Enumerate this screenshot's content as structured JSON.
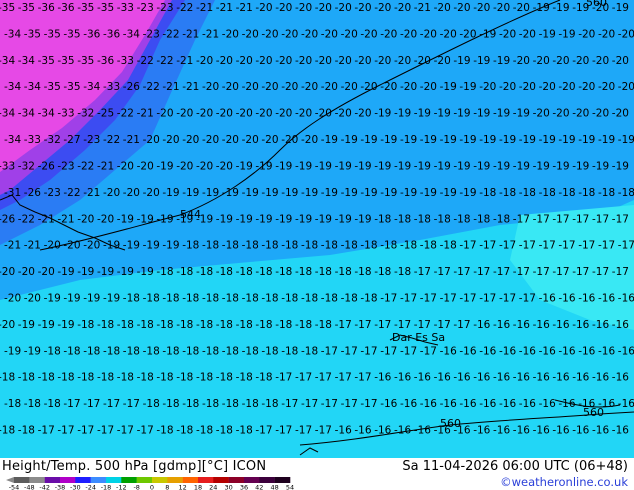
{
  "map": {
    "grid_values": [
      [
        "-35",
        "-35",
        "-36",
        "-36",
        "-35",
        "-35",
        "-33",
        "-23",
        "-23",
        "-22",
        "-21",
        "-21",
        "-21",
        "-20",
        "-20",
        "-20",
        "-20",
        "-20",
        "-20",
        "-20",
        "-20",
        "-21",
        "-20",
        "-20",
        "-20",
        "-20",
        "-20",
        "-19",
        "-19",
        "-19",
        "-20",
        "-19"
      ],
      [
        "-34",
        "-35",
        "-35",
        "-35",
        "-36",
        "-36",
        "-34",
        "-23",
        "-22",
        "-21",
        "-21",
        "-20",
        "-20",
        "-20",
        "-20",
        "-20",
        "-20",
        "-20",
        "-20",
        "-20",
        "-20",
        "-20",
        "-20",
        "-20",
        "-19",
        "-20",
        "-20",
        "-19",
        "-19",
        "-20",
        "-20",
        "-20"
      ],
      [
        "-34",
        "-34",
        "-35",
        "-35",
        "-35",
        "-36",
        "-33",
        "-22",
        "-22",
        "-21",
        "-20",
        "-20",
        "-20",
        "-20",
        "-20",
        "-20",
        "-20",
        "-20",
        "-20",
        "-20",
        "-20",
        "-20",
        "-20",
        "-19",
        "-19",
        "-19",
        "-20",
        "-20",
        "-20",
        "-20",
        "-20",
        "-20"
      ],
      [
        "-34",
        "-34",
        "-35",
        "-35",
        "-34",
        "-33",
        "-26",
        "-22",
        "-21",
        "-21",
        "-20",
        "-20",
        "-20",
        "-20",
        "-20",
        "-20",
        "-20",
        "-20",
        "-20",
        "-20",
        "-20",
        "-20",
        "-19",
        "-19",
        "-20",
        "-20",
        "-20",
        "-20",
        "-20",
        "-20",
        "-20",
        "-20"
      ],
      [
        "-34",
        "-34",
        "-34",
        "-33",
        "-32",
        "-25",
        "-22",
        "-21",
        "-20",
        "-20",
        "-20",
        "-20",
        "-20",
        "-20",
        "-20",
        "-20",
        "-20",
        "-20",
        "-20",
        "-19",
        "-19",
        "-19",
        "-19",
        "-19",
        "-19",
        "-19",
        "-19",
        "-20",
        "-20",
        "-20",
        "-20",
        "-20"
      ],
      [
        "-34",
        "-33",
        "-32",
        "-27",
        "-23",
        "-22",
        "-21",
        "-20",
        "-20",
        "-20",
        "-20",
        "-20",
        "-20",
        "-20",
        "-20",
        "-20",
        "-19",
        "-19",
        "-19",
        "-19",
        "-19",
        "-19",
        "-19",
        "-19",
        "-19",
        "-19",
        "-19",
        "-19",
        "-19",
        "-19",
        "-19",
        "-19"
      ],
      [
        "-33",
        "-32",
        "-26",
        "-23",
        "-22",
        "-21",
        "-20",
        "-20",
        "-19",
        "-20",
        "-20",
        "-20",
        "-19",
        "-19",
        "-19",
        "-19",
        "-19",
        "-19",
        "-19",
        "-19",
        "-19",
        "-19",
        "-19",
        "-19",
        "-19",
        "-19",
        "-19",
        "-19",
        "-19",
        "-19",
        "-19",
        "-19"
      ],
      [
        "-31",
        "-26",
        "-23",
        "-22",
        "-21",
        "-20",
        "-20",
        "-20",
        "-19",
        "-19",
        "-19",
        "-19",
        "-19",
        "-19",
        "-19",
        "-19",
        "-19",
        "-19",
        "-19",
        "-19",
        "-19",
        "-19",
        "-19",
        "-19",
        "-18",
        "-18",
        "-18",
        "-18",
        "-18",
        "-18",
        "-18",
        "-18"
      ],
      [
        "-26",
        "-22",
        "-21",
        "-21",
        "-20",
        "-20",
        "-19",
        "-19",
        "-19",
        "-19",
        "-19",
        "-19",
        "-19",
        "-19",
        "-19",
        "-19",
        "-19",
        "-19",
        "-19",
        "-18",
        "-18",
        "-18",
        "-18",
        "-18",
        "-18",
        "-18",
        "-17",
        "-17",
        "-17",
        "-17",
        "-17",
        "-17"
      ],
      [
        "-21",
        "-21",
        "-20",
        "-20",
        "-20",
        "-19",
        "-19",
        "-19",
        "-19",
        "-18",
        "-18",
        "-18",
        "-18",
        "-18",
        "-18",
        "-18",
        "-18",
        "-18",
        "-18",
        "-18",
        "-18",
        "-18",
        "-18",
        "-17",
        "-17",
        "-17",
        "-17",
        "-17",
        "-17",
        "-17",
        "-17",
        "-17"
      ],
      [
        "-20",
        "-20",
        "-20",
        "-19",
        "-19",
        "-19",
        "-19",
        "-19",
        "-18",
        "-18",
        "-18",
        "-18",
        "-18",
        "-18",
        "-18",
        "-18",
        "-18",
        "-18",
        "-18",
        "-18",
        "-18",
        "-17",
        "-17",
        "-17",
        "-17",
        "-17",
        "-17",
        "-17",
        "-17",
        "-17",
        "-17",
        "-17"
      ],
      [
        "-20",
        "-20",
        "-19",
        "-19",
        "-19",
        "-19",
        "-18",
        "-18",
        "-18",
        "-18",
        "-18",
        "-18",
        "-18",
        "-18",
        "-18",
        "-18",
        "-18",
        "-18",
        "-18",
        "-17",
        "-17",
        "-17",
        "-17",
        "-17",
        "-17",
        "-17",
        "-17",
        "-16",
        "-16",
        "-16",
        "-16",
        "-16"
      ],
      [
        "-20",
        "-19",
        "-19",
        "-19",
        "-18",
        "-18",
        "-18",
        "-18",
        "-18",
        "-18",
        "-18",
        "-18",
        "-18",
        "-18",
        "-18",
        "-18",
        "-18",
        "-17",
        "-17",
        "-17",
        "-17",
        "-17",
        "-17",
        "-17",
        "-16",
        "-16",
        "-16",
        "-16",
        "-16",
        "-16",
        "-16",
        "-16"
      ],
      [
        "-19",
        "-19",
        "-18",
        "-18",
        "-18",
        "-18",
        "-18",
        "-18",
        "-18",
        "-18",
        "-18",
        "-18",
        "-18",
        "-18",
        "-18",
        "-18",
        "-17",
        "-17",
        "-17",
        "-17",
        "-17",
        "-17",
        "-16",
        "-16",
        "-16",
        "-16",
        "-16",
        "-16",
        "-16",
        "-16",
        "-16",
        "-16"
      ],
      [
        "-18",
        "-18",
        "-18",
        "-18",
        "-18",
        "-18",
        "-18",
        "-18",
        "-18",
        "-18",
        "-18",
        "-18",
        "-18",
        "-18",
        "-17",
        "-17",
        "-17",
        "-17",
        "-17",
        "-16",
        "-16",
        "-16",
        "-16",
        "-16",
        "-16",
        "-16",
        "-16",
        "-16",
        "-16",
        "-16",
        "-16",
        "-16"
      ],
      [
        "-18",
        "-18",
        "-18",
        "-17",
        "-17",
        "-17",
        "-17",
        "-18",
        "-18",
        "-18",
        "-18",
        "-18",
        "-18",
        "-18",
        "-17",
        "-17",
        "-17",
        "-17",
        "-17",
        "-16",
        "-16",
        "-16",
        "-16",
        "-16",
        "-16",
        "-16",
        "-16",
        "-16",
        "-16",
        "-16",
        "-16",
        "-16"
      ],
      [
        "-18",
        "-18",
        "-17",
        "-17",
        "-17",
        "-17",
        "-17",
        "-17",
        "-18",
        "-18",
        "-18",
        "-18",
        "-18",
        "-17",
        "-17",
        "-17",
        "-17",
        "-16",
        "-16",
        "-16",
        "-16",
        "-16",
        "-16",
        "-16",
        "-16",
        "-16",
        "-16",
        "-16",
        "-16",
        "-16",
        "-16",
        "-16"
      ]
    ],
    "contour_labels": [
      "544",
      "560",
      "560",
      "560"
    ],
    "city_label": "Dar Es Sa"
  },
  "footer": {
    "title": "Height/Temp. 500 hPa [gdmp][°C] ICON",
    "datetime": "Sa 11-04-2026 06:00 UTC (06+48)",
    "credit": "©weatheronline.co.uk"
  },
  "colorbar": {
    "ticks": [
      "-54",
      "-48",
      "-42",
      "-38",
      "-30",
      "-24",
      "-18",
      "-12",
      "-8",
      "0",
      "8",
      "12",
      "18",
      "24",
      "30",
      "36",
      "42",
      "48",
      "54"
    ],
    "colors": [
      "#5c5c5c",
      "#8c8c8c",
      "#6a0da8",
      "#b000c8",
      "#1e1eff",
      "#3c8cff",
      "#00d2e6",
      "#00a000",
      "#6ec800",
      "#c8c800",
      "#e6a000",
      "#ff6400",
      "#e61e1e",
      "#b40000",
      "#8c0028",
      "#640050",
      "#3c003c",
      "#1e001e"
    ]
  },
  "colors": {
    "magenta": "#e649e6",
    "violet": "#a040e8",
    "royal_blue": "#3c4cf2",
    "blue": "#2a7cf4",
    "sky": "#1ea8f8",
    "cyan": "#22d6f6",
    "light_cyan": "#39e8f4",
    "credit_blue": "#2a3fd8"
  }
}
